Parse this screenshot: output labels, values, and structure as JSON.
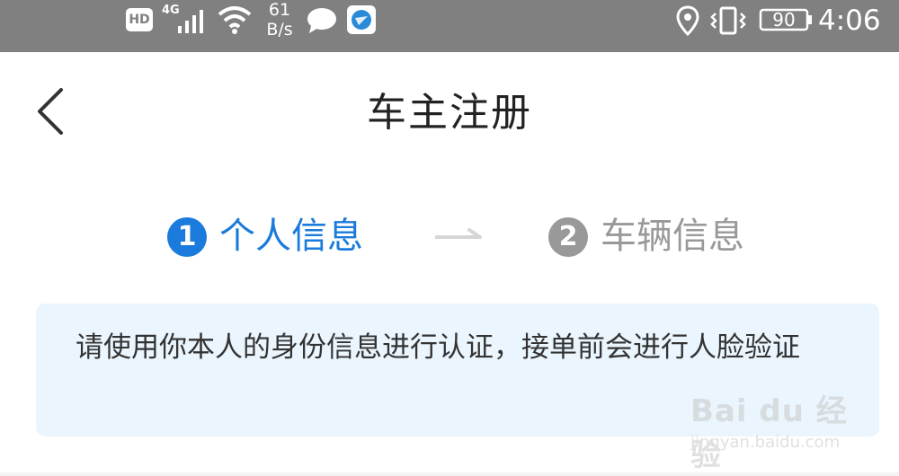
{
  "status_bar": {
    "hd": "HD",
    "network": "4G",
    "speed_value": "61",
    "speed_unit": "B/s",
    "battery": "90",
    "time": "4:06",
    "icons": [
      "signal-icon",
      "wifi-icon",
      "chat-icon",
      "app-icon",
      "location-icon",
      "vibrate-icon",
      "battery-icon"
    ]
  },
  "header": {
    "title": "车主注册",
    "back_icon": "chevron-left-icon"
  },
  "steps": [
    {
      "number": "1",
      "label": "个人信息",
      "active": true
    },
    {
      "number": "2",
      "label": "车辆信息",
      "active": false
    }
  ],
  "notice": {
    "text": "请使用你本人的身份信息进行认证，接单前会进行人脸验证"
  },
  "watermark": {
    "logo": "Bai du 经验",
    "url": "jingyan.baidu.com"
  },
  "colors": {
    "status_bar_bg": "#808080",
    "accent": "#1a7bdc",
    "inactive": "#999999",
    "notice_bg": "#eaf5fd"
  }
}
